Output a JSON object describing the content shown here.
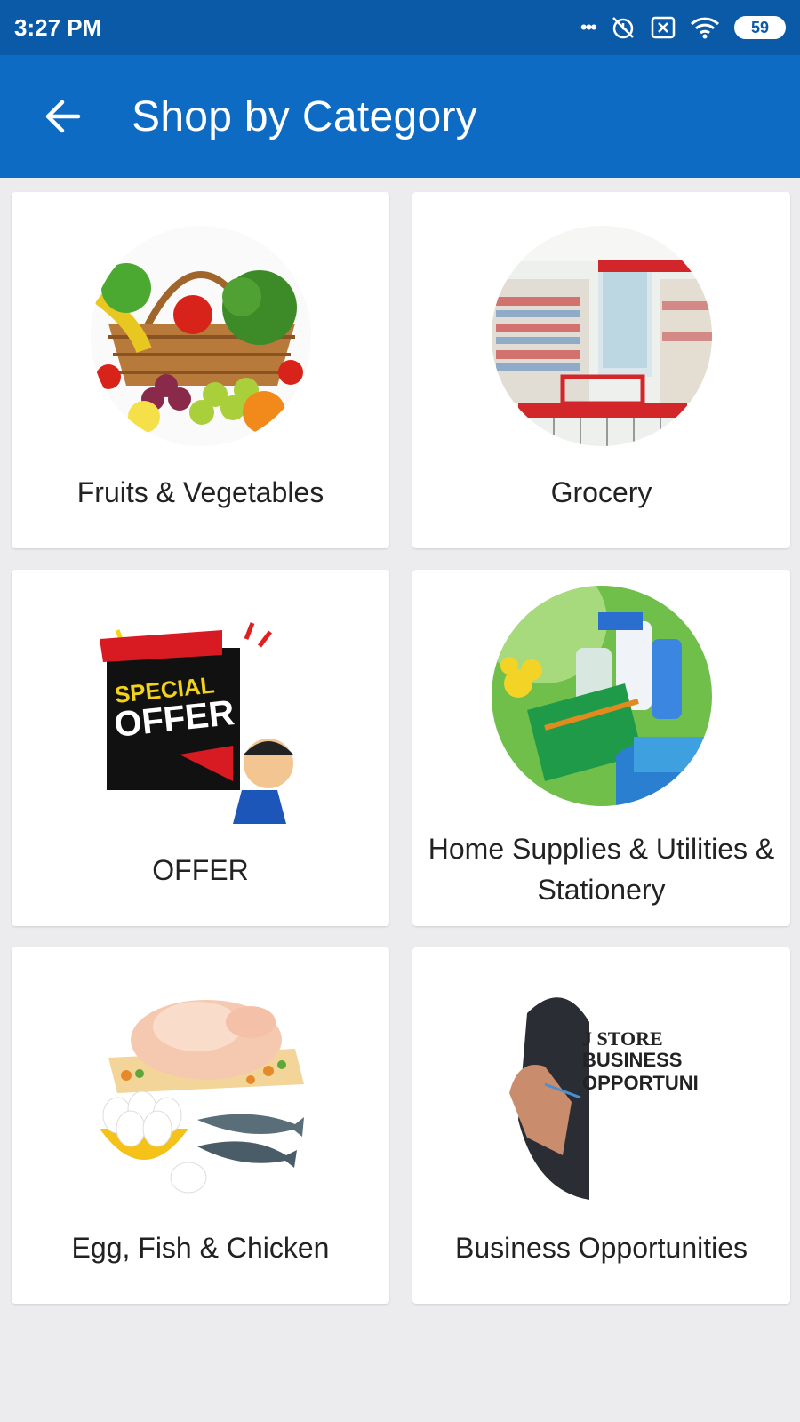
{
  "status_bar": {
    "time": "3:27 PM",
    "dots": "•••",
    "battery": "59"
  },
  "app_bar": {
    "title": "Shop by Category"
  },
  "categories": [
    {
      "label": "Fruits & Vegetables",
      "icon": "fruit-basket-image"
    },
    {
      "label": "Grocery",
      "icon": "grocery-store-image"
    },
    {
      "label": "OFFER",
      "icon": "special-offer-image",
      "badge_line1": "SPECIAL",
      "badge_line2": "OFFER"
    },
    {
      "label": "Home Supplies & Utilities & Stationery",
      "icon": "cleaning-supplies-image"
    },
    {
      "label": "Egg, Fish & Chicken",
      "icon": "meat-eggs-image"
    },
    {
      "label": "Business Opportunities",
      "icon": "business-image",
      "img_line1": "J STORE",
      "img_line2": "BUSINESS",
      "img_line3": "OPPORTUNI"
    }
  ],
  "colors": {
    "status_bar": "#0a5aa8",
    "app_bar": "#0e6bc4",
    "background": "#ececee"
  }
}
